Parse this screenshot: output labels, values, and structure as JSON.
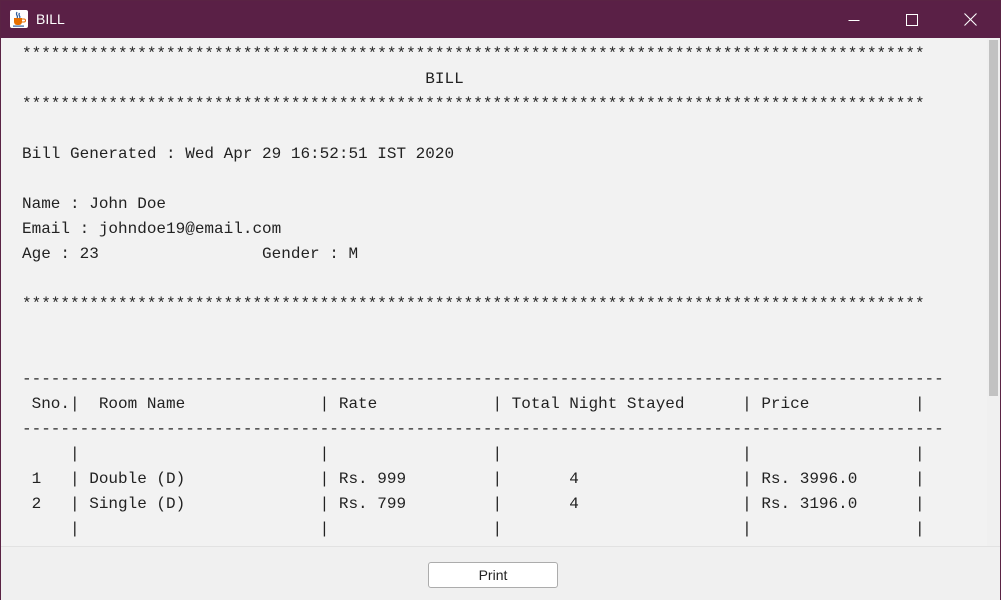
{
  "window": {
    "title": "BILL",
    "icon": "java-cup-icon",
    "titlebar_color": "#5a2046"
  },
  "bill": {
    "lines": [
      "**********************************************************************************************",
      "                                          BILL",
      "**********************************************************************************************",
      "",
      "Bill Generated : Wed Apr 29 16:52:51 IST 2020",
      "",
      "Name : John Doe",
      "Email : johndoe19@email.com",
      "Age : 23                 Gender : M",
      "",
      "**********************************************************************************************",
      "",
      "",
      "------------------------------------------------------------------------------------------------",
      " Sno.|  Room Name              | Rate            | Total Night Stayed      | Price           |",
      "------------------------------------------------------------------------------------------------",
      "     |                         |                 |                         |                 |",
      " 1   | Double (D)              | Rs. 999         |       4                 | Rs. 3996.0      |",
      " 2   | Single (D)              | Rs. 799         |       4                 | Rs. 3196.0      |",
      "     |                         |                 |                         |                 |"
    ]
  },
  "actions": {
    "print_label": "Print"
  }
}
